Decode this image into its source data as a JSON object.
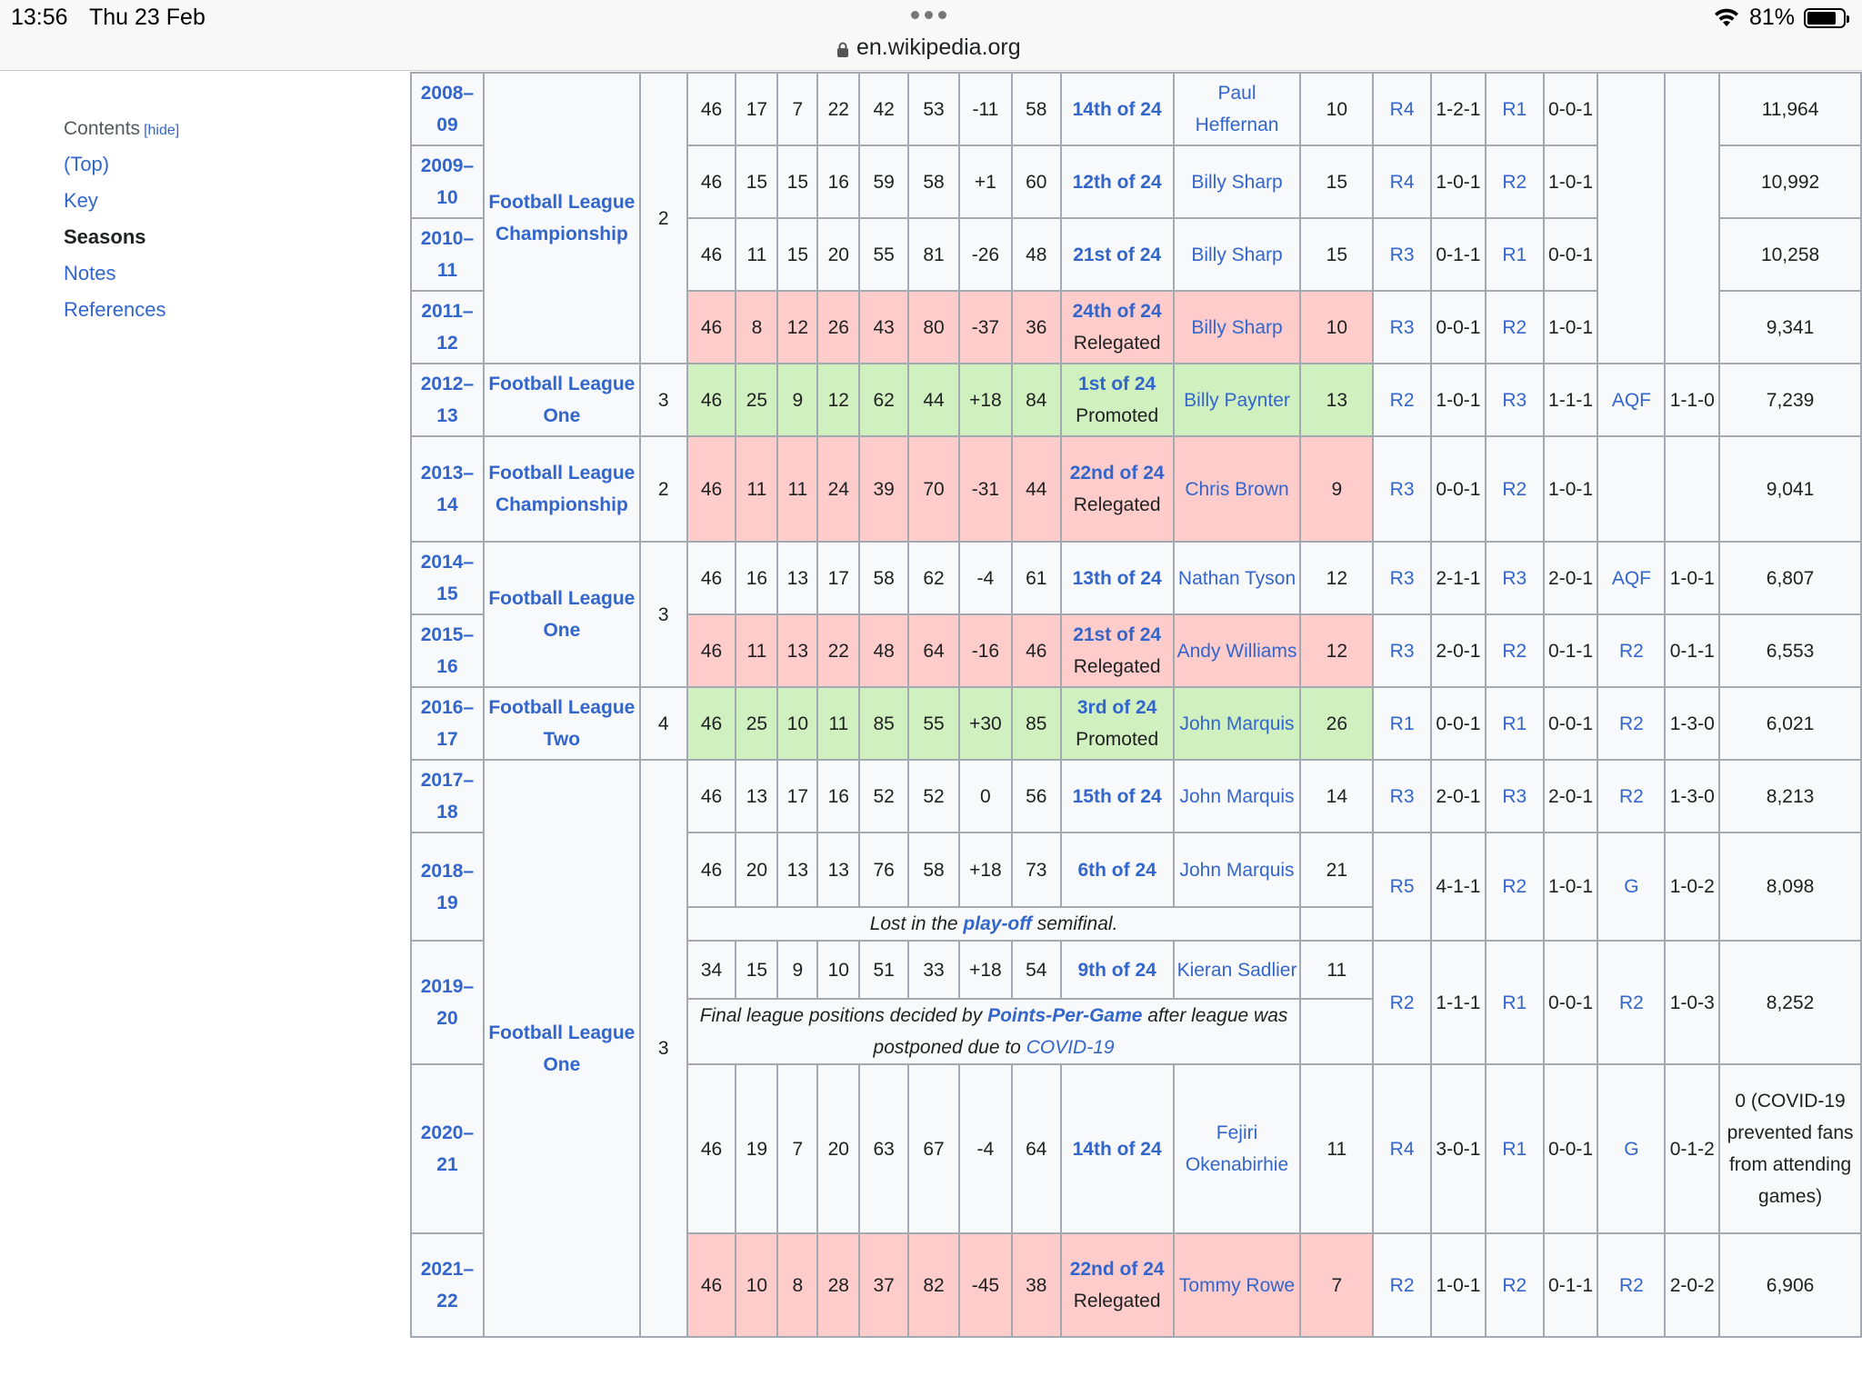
{
  "status_bar": {
    "time": "13:56",
    "date": "Thu 23 Feb",
    "url": "en.wikipedia.org",
    "battery": "81%",
    "battery_level": 0.81
  },
  "toc": {
    "title": "Contents",
    "hide": "[hide]",
    "items": [
      "(Top)",
      "Key",
      "Seasons",
      "Notes",
      "References"
    ],
    "active_item": "Seasons"
  },
  "table": {
    "leagues": {
      "championship": "Football League Championship",
      "one": "Football League One",
      "two": "Football League Two"
    },
    "rows": [
      {
        "season": "2008–09",
        "p": "46",
        "w": "17",
        "d": "7",
        "l": "22",
        "f": "42",
        "a": "53",
        "gd": "-11",
        "pts": "58",
        "pos": "14th of 24",
        "scorer": "Paul Heffernan",
        "goals": "10",
        "fa": "R4",
        "fa_rec": "1-2-1",
        "lc": "R1",
        "lc_rec": "0-0-1",
        "status": "plain"
      },
      {
        "season": "2009–10",
        "p": "46",
        "w": "15",
        "d": "15",
        "l": "16",
        "f": "59",
        "a": "58",
        "gd": "+1",
        "pts": "60",
        "pos": "12th of 24",
        "scorer": "Billy Sharp",
        "goals": "15",
        "fa": "R4",
        "fa_rec": "1-0-1",
        "lc": "R2",
        "lc_rec": "1-0-1",
        "status": "plain"
      },
      {
        "season": "2010–11",
        "p": "46",
        "w": "11",
        "d": "15",
        "l": "20",
        "f": "55",
        "a": "81",
        "gd": "-26",
        "pts": "48",
        "pos": "21st of 24",
        "scorer": "Billy Sharp",
        "goals": "15",
        "fa": "R3",
        "fa_rec": "0-1-1",
        "lc": "R1",
        "lc_rec": "0-0-1",
        "status": "plain"
      },
      {
        "season": "2011–12",
        "p": "46",
        "w": "8",
        "d": "12",
        "l": "26",
        "f": "43",
        "a": "80",
        "gd": "-37",
        "pts": "36",
        "pos": "24th of 24",
        "pos_note": "Relegated",
        "scorer": "Billy Sharp",
        "goals": "10",
        "fa": "R3",
        "fa_rec": "0-0-1",
        "lc": "R2",
        "lc_rec": "1-0-1",
        "status": "relegated"
      },
      {
        "season": "2012–13",
        "tier": "3",
        "p": "46",
        "w": "25",
        "d": "9",
        "l": "12",
        "f": "62",
        "a": "44",
        "gd": "+18",
        "pts": "84",
        "pos": "1st of 24",
        "pos_note": "Promoted",
        "scorer": "Billy Paynter",
        "goals": "13",
        "fa": "R2",
        "fa_rec": "1-0-1",
        "lc": "R3",
        "lc_rec": "1-1-1",
        "other": "AQF",
        "other_rec": "1-1-0",
        "att": "7,239",
        "status": "promoted"
      },
      {
        "season": "2013–14",
        "tier": "2",
        "p": "46",
        "w": "11",
        "d": "11",
        "l": "24",
        "f": "39",
        "a": "70",
        "gd": "-31",
        "pts": "44",
        "pos": "22nd of 24",
        "pos_note": "Relegated",
        "scorer": "Chris Brown",
        "goals": "9",
        "fa": "R3",
        "fa_rec": "0-0-1",
        "lc": "R2",
        "lc_rec": "1-0-1",
        "att": "9,041",
        "status": "relegated"
      },
      {
        "season": "2014–15",
        "p": "46",
        "w": "16",
        "d": "13",
        "l": "17",
        "f": "58",
        "a": "62",
        "gd": "-4",
        "pts": "61",
        "pos": "13th of 24",
        "scorer": "Nathan Tyson",
        "goals": "12",
        "fa": "R3",
        "fa_rec": "2-1-1",
        "lc": "R3",
        "lc_rec": "2-0-1",
        "other": "AQF",
        "other_rec": "1-0-1",
        "att": "6,807",
        "status": "plain"
      },
      {
        "season": "2015–16",
        "p": "46",
        "w": "11",
        "d": "13",
        "l": "22",
        "f": "48",
        "a": "64",
        "gd": "-16",
        "pts": "46",
        "pos": "21st of 24",
        "pos_note": "Relegated",
        "scorer": "Andy Williams",
        "goals": "12",
        "fa": "R3",
        "fa_rec": "2-0-1",
        "lc": "R2",
        "lc_rec": "0-1-1",
        "other": "R2",
        "other_rec": "0-1-1",
        "att": "6,553",
        "status": "relegated"
      },
      {
        "season": "2016–17",
        "tier": "4",
        "p": "46",
        "w": "25",
        "d": "10",
        "l": "11",
        "f": "85",
        "a": "55",
        "gd": "+30",
        "pts": "85",
        "pos": "3rd of 24",
        "pos_note": "Promoted",
        "scorer": "John Marquis",
        "goals": "26",
        "fa": "R1",
        "fa_rec": "0-0-1",
        "lc": "R1",
        "lc_rec": "0-0-1",
        "other": "R2",
        "other_rec": "1-3-0",
        "att": "6,021",
        "status": "promoted"
      },
      {
        "season": "2017–18",
        "p": "46",
        "w": "13",
        "d": "17",
        "l": "16",
        "f": "52",
        "a": "52",
        "gd": "0",
        "pts": "56",
        "pos": "15th of 24",
        "scorer": "John Marquis",
        "goals": "14",
        "fa": "R3",
        "fa_rec": "2-0-1",
        "lc": "R3",
        "lc_rec": "2-0-1",
        "other": "R2",
        "other_rec": "1-3-0",
        "att": "8,213",
        "status": "plain"
      },
      {
        "season": "2018–19",
        "p": "46",
        "w": "20",
        "d": "13",
        "l": "13",
        "f": "76",
        "a": "58",
        "gd": "+18",
        "pts": "73",
        "pos": "6th of 24",
        "scorer": "John Marquis",
        "goals": "21",
        "fa": "R5",
        "fa_rec": "4-1-1",
        "lc": "R2",
        "lc_rec": "1-0-1",
        "other": "G",
        "other_rec": "1-0-2",
        "att": "8,098",
        "status": "plain",
        "note_pre": "Lost in the ",
        "note_link": "play-off",
        "note_post": " semifinal."
      },
      {
        "season": "2019–20",
        "p": "34",
        "w": "15",
        "d": "9",
        "l": "10",
        "f": "51",
        "a": "33",
        "gd": "+18",
        "pts": "54",
        "pos": "9th of 24",
        "scorer": "Kieran Sadlier",
        "goals": "11",
        "fa": "R2",
        "fa_rec": "1-1-1",
        "lc": "R1",
        "lc_rec": "0-0-1",
        "other": "R2",
        "other_rec": "1-0-3",
        "att": "8,252",
        "status": "plain",
        "note_pre": "Final league positions decided by ",
        "note_link": "Points-Per-Game",
        "note_mid": " after league was postponed due to ",
        "note_link2": "COVID-19"
      },
      {
        "season": "2020–21",
        "p": "46",
        "w": "19",
        "d": "7",
        "l": "20",
        "f": "63",
        "a": "67",
        "gd": "-4",
        "pts": "64",
        "pos": "14th of 24",
        "scorer": "Fejiri Okenabirhie",
        "goals": "11",
        "fa": "R4",
        "fa_rec": "3-0-1",
        "lc": "R1",
        "lc_rec": "0-0-1",
        "other": "G",
        "other_rec": "0-1-2",
        "att": "0 (COVID-19 prevented fans from attending games)",
        "status": "plain"
      },
      {
        "season": "2021–22",
        "p": "46",
        "w": "10",
        "d": "8",
        "l": "28",
        "f": "37",
        "a": "82",
        "gd": "-45",
        "pts": "38",
        "pos": "22nd of 24",
        "pos_note": "Relegated",
        "scorer": "Tommy Rowe",
        "goals": "7",
        "fa": "R2",
        "fa_rec": "1-0-1",
        "lc": "R2",
        "lc_rec": "0-1-1",
        "other": "R2",
        "other_rec": "2-0-2",
        "att": "6,906",
        "status": "relegated"
      }
    ],
    "group_tier_2008": "2",
    "group_tier_2014": "3",
    "group_tier_2017": "3",
    "att_2008": "11,964",
    "att_2009": "10,992",
    "att_2010": "10,258",
    "att_2011": "9,341"
  }
}
